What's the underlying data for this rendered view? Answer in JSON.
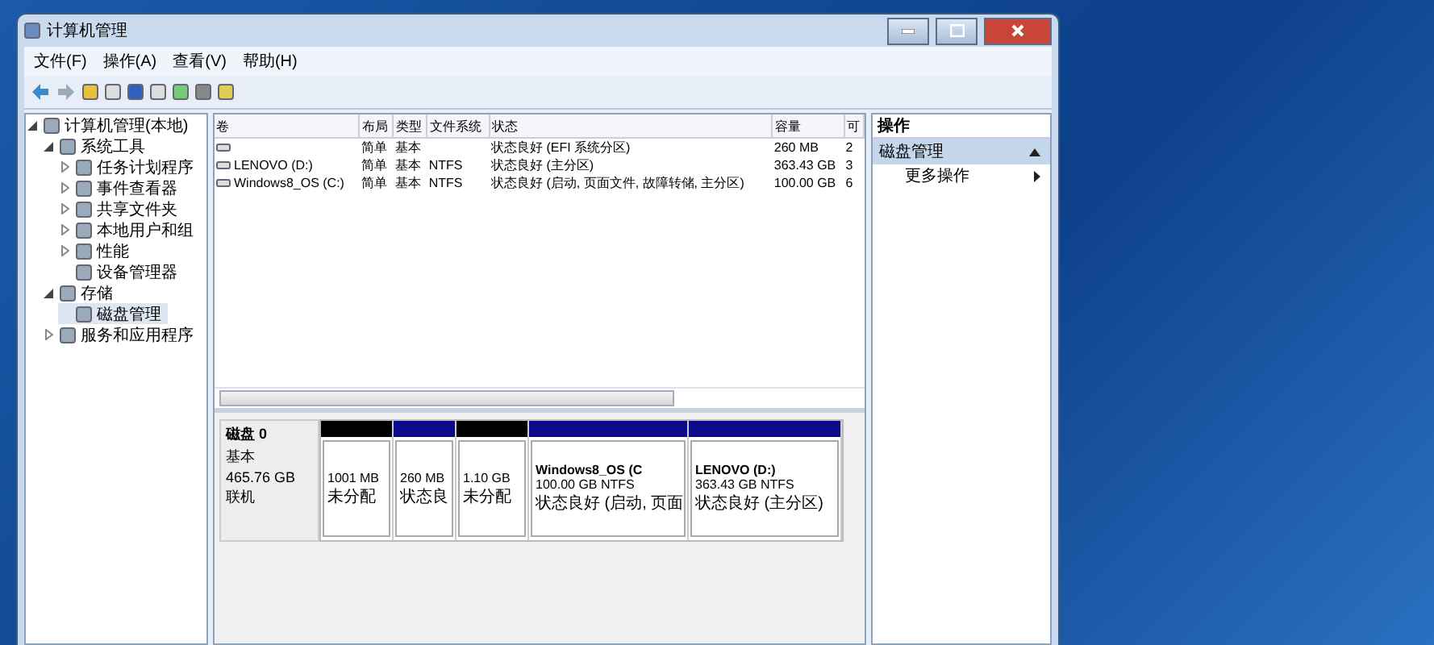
{
  "window": {
    "title": "计算机管理"
  },
  "menu": [
    "文件(F)",
    "操作(A)",
    "查看(V)",
    "帮助(H)"
  ],
  "tree": [
    {
      "label": "计算机管理(本地)",
      "expanded": true,
      "selected": false,
      "children": [
        {
          "label": "系统工具",
          "expanded": true,
          "selected": false,
          "children": [
            {
              "label": "任务计划程序",
              "expanded": false,
              "selected": false
            },
            {
              "label": "事件查看器",
              "expanded": false,
              "selected": false
            },
            {
              "label": "共享文件夹",
              "expanded": false,
              "selected": false
            },
            {
              "label": "本地用户和组",
              "expanded": false,
              "selected": false
            },
            {
              "label": "性能",
              "expanded": false,
              "selected": false
            },
            {
              "label": "设备管理器",
              "selected": false
            }
          ]
        },
        {
          "label": "存储",
          "expanded": true,
          "selected": false,
          "children": [
            {
              "label": "磁盘管理",
              "selected": true
            }
          ]
        },
        {
          "label": "服务和应用程序",
          "expanded": false,
          "selected": false
        }
      ]
    }
  ],
  "table": {
    "columns": [
      "卷",
      "布局",
      "类型",
      "文件系统",
      "状态",
      "容量",
      "可"
    ],
    "rows": [
      [
        "",
        "简单",
        "基本",
        "",
        "状态良好 (EFI 系统分区)",
        "260 MB",
        "2"
      ],
      [
        "LENOVO (D:)",
        "简单",
        "基本",
        "NTFS",
        "状态良好 (主分区)",
        "363.43 GB",
        "3"
      ],
      [
        "Windows8_OS (C:)",
        "简单",
        "基本",
        "NTFS",
        "状态良好 (启动, 页面文件, 故障转储, 主分区)",
        "100.00 GB",
        "6"
      ]
    ]
  },
  "disk": {
    "name": "磁盘 0",
    "type": "基本",
    "size": "465.76 GB",
    "status": "联机",
    "partitions": [
      {
        "kind": "unallocated",
        "size": "1001 MB",
        "status": "未分配"
      },
      {
        "kind": "primary",
        "size": "260 MB",
        "status": "状态良"
      },
      {
        "kind": "unallocated",
        "size": "1.10 GB",
        "status": "未分配"
      },
      {
        "kind": "primary",
        "name": "Windows8_OS  (C",
        "size": "100.00 GB NTFS",
        "status": "状态良好 (启动, 页面"
      },
      {
        "kind": "primary",
        "name": "LENOVO  (D:)",
        "size": "363.43 GB NTFS",
        "status": "状态良好 (主分区)"
      }
    ]
  },
  "actions": {
    "header": "操作",
    "section": "磁盘管理",
    "items": [
      "更多操作"
    ]
  }
}
